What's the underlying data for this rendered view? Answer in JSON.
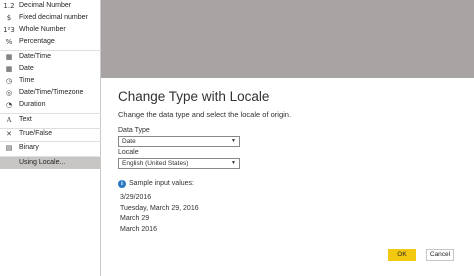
{
  "menu": {
    "items": [
      {
        "icon": "1.2",
        "icon_name": "decimal-icon",
        "label": "Decimal Number"
      },
      {
        "icon": "$",
        "icon_name": "dollar-icon",
        "label": "Fixed decimal number"
      },
      {
        "icon": "1²3",
        "icon_name": "whole-number-icon",
        "label": "Whole Number"
      },
      {
        "icon": "%",
        "icon_name": "percent-icon",
        "label": "Percentage"
      },
      {
        "icon": "▦",
        "icon_name": "datetime-icon",
        "label": "Date/Time"
      },
      {
        "icon": "▦",
        "icon_name": "calendar-icon",
        "label": "Date"
      },
      {
        "icon": "◷",
        "icon_name": "clock-icon",
        "label": "Time"
      },
      {
        "icon": "◎",
        "icon_name": "globe-icon",
        "label": "Date/Time/Timezone"
      },
      {
        "icon": "◔",
        "icon_name": "stopwatch-icon",
        "label": "Duration"
      },
      {
        "icon": "A",
        "icon_name": "text-icon",
        "label": "Text"
      },
      {
        "icon": "✕",
        "icon_name": "true-false-icon",
        "label": "True/False"
      },
      {
        "icon": "▤",
        "icon_name": "binary-icon",
        "label": "Binary"
      },
      {
        "icon": "",
        "icon_name": "",
        "label": "Using Locale..."
      }
    ]
  },
  "dialog": {
    "title": "Change Type with Locale",
    "subtitle": "Change the data type and select the locale of origin.",
    "data_type_label": "Data Type",
    "data_type_value": "Date",
    "locale_label": "Locale",
    "locale_value": "English (United States)",
    "sample_title": "Sample input values:",
    "samples": [
      "3/29/2016",
      "Tuesday, March 29, 2016",
      "March 29",
      "March 2016"
    ],
    "ok_label": "OK",
    "cancel_label": "Cancel"
  },
  "colors": {
    "accent": "#f2c811",
    "info": "#2b79c2",
    "overlay": "#a7a4a3"
  }
}
